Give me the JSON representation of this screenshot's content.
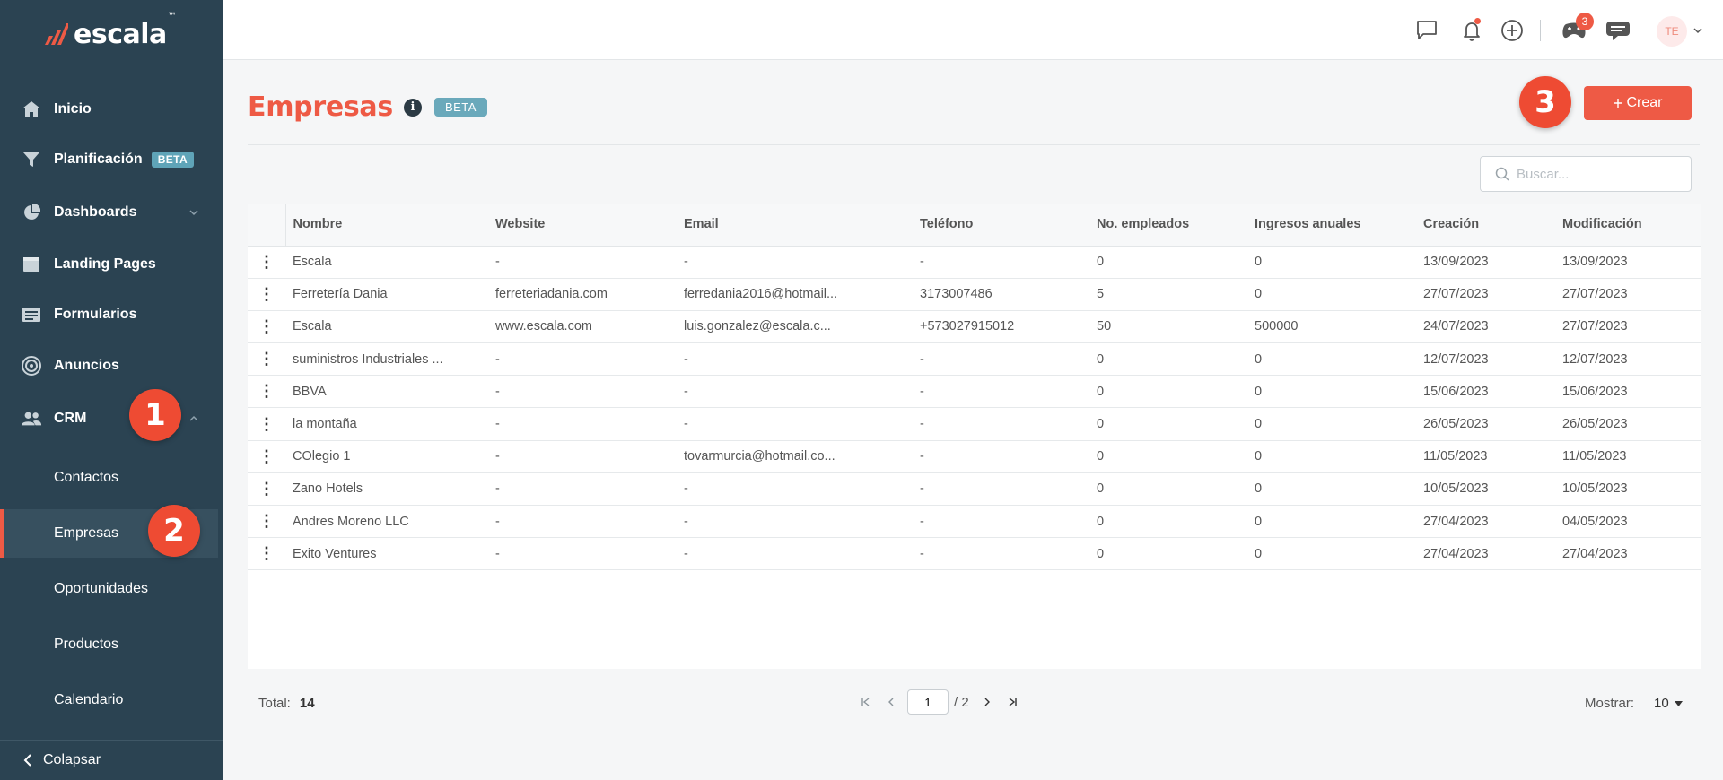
{
  "brand": {
    "name": "escala",
    "tm": "™"
  },
  "sidebar": {
    "items": [
      {
        "label": "Inicio",
        "icon": "home-icon"
      },
      {
        "label": "Planificación",
        "icon": "funnel-icon",
        "badge": "BETA"
      },
      {
        "label": "Dashboards",
        "icon": "pie-chart-icon"
      },
      {
        "label": "Landing Pages",
        "icon": "browser-icon"
      },
      {
        "label": "Formularios",
        "icon": "form-icon"
      },
      {
        "label": "Anuncios",
        "icon": "target-icon"
      },
      {
        "label": "CRM",
        "icon": "users-icon"
      }
    ],
    "crm_sub": [
      "Contactos",
      "Empresas",
      "Oportunidades",
      "Productos",
      "Calendario"
    ],
    "collapse_label": "Colapsar"
  },
  "steps": [
    "1",
    "2",
    "3"
  ],
  "topbar": {
    "notifications_badge": "3",
    "avatar_initials": "TE"
  },
  "page": {
    "title": "Empresas",
    "beta_label": "BETA",
    "create_label": "Crear",
    "search_placeholder": "Buscar..."
  },
  "table": {
    "columns": [
      "Nombre",
      "Website",
      "Email",
      "Teléfono",
      "No. empleados",
      "Ingresos anuales",
      "Creación",
      "Modificación"
    ],
    "rows": [
      [
        "Escala",
        "-",
        "-",
        "-",
        "0",
        "0",
        "13/09/2023",
        "13/09/2023"
      ],
      [
        "Ferretería Dania",
        "ferreteriadania.com",
        "ferredania2016@hotmail...",
        "3173007486",
        "5",
        "0",
        "27/07/2023",
        "27/07/2023"
      ],
      [
        "Escala",
        "www.escala.com",
        "luis.gonzalez@escala.c...",
        "+573027915012",
        "50",
        "500000",
        "24/07/2023",
        "27/07/2023"
      ],
      [
        "suministros Industriales ...",
        "-",
        "-",
        "-",
        "0",
        "0",
        "12/07/2023",
        "12/07/2023"
      ],
      [
        "BBVA",
        "-",
        "-",
        "-",
        "0",
        "0",
        "15/06/2023",
        "15/06/2023"
      ],
      [
        "la montaña",
        "-",
        "-",
        "-",
        "0",
        "0",
        "26/05/2023",
        "26/05/2023"
      ],
      [
        "COlegio 1",
        "-",
        "tovarmurcia@hotmail.co...",
        "-",
        "0",
        "0",
        "11/05/2023",
        "11/05/2023"
      ],
      [
        "Zano Hotels",
        "-",
        "-",
        "-",
        "0",
        "0",
        "10/05/2023",
        "10/05/2023"
      ],
      [
        "Andres Moreno LLC",
        "-",
        "-",
        "-",
        "0",
        "0",
        "27/04/2023",
        "04/05/2023"
      ],
      [
        "Exito Ventures",
        "-",
        "-",
        "-",
        "0",
        "0",
        "27/04/2023",
        "27/04/2023"
      ]
    ]
  },
  "footer": {
    "total_label": "Total:",
    "total_value": "14",
    "page_current": "1",
    "page_sep": "/",
    "page_total": "2",
    "show_label": "Mostrar:",
    "show_value": "10"
  },
  "colors": {
    "sidebar": "#2b4352",
    "accent": "#ee5a45",
    "beta": "#6aa9bb"
  }
}
